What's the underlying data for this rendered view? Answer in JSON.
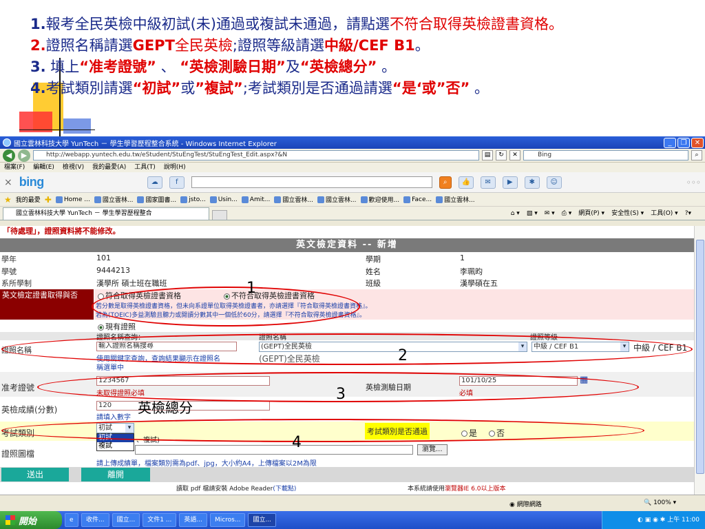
{
  "slide": {
    "line1": {
      "num": "1.",
      "text": "報考全民英檢中級初試(未)通過或複試未通過，請點選",
      "highlight": "不符合取得英檢證書資格。"
    },
    "line2": {
      "num": "2.",
      "text_a": "證照名稱請選",
      "bold_a": "GEPT",
      "red_a": "全民英檢",
      "text_b": ";證照等級請選",
      "red_b": "中級/CEF  B1",
      "end": "。"
    },
    "line3": {
      "num": "3.",
      "text": " 填上",
      "q1": "“准考證號”",
      "sep1": " 、 ",
      "q2": "“英檢測驗日期”",
      "and": "及",
      "q3": "“英檢總分”",
      "end": " 。"
    },
    "line4": {
      "num": "4.",
      "text_a": "考試類別請選",
      "q1": "“初試”",
      "or1": "或",
      "q2": "”複試”",
      "text_b": ";考試類別是否通過請選",
      "q3": "“是‘或”否”",
      "end": " 。"
    }
  },
  "browser": {
    "title": "國立雲林科技大學 YunTech － 學生學習歷程整合系統 - Windows Internet Explorer",
    "url": "http://webapp.yuntech.edu.tw/eStudent/StuEngTest/StuEngTest_Edit.aspx?&N",
    "search_placeholder": "Bing",
    "menu": [
      "檔案(F)",
      "編輯(E)",
      "檢視(V)",
      "我的最愛(A)",
      "工具(T)",
      "說明(H)"
    ],
    "bing_logo": "bing",
    "favorites_label": "我的最愛",
    "favorites": [
      "Home ...",
      "國立雲林...",
      "國家圖書...",
      "jsto...",
      "Usin...",
      "Amit...",
      "國立雲林...",
      "國立雲林...",
      "歡迎使用...",
      "Face...",
      "國立雲林..."
    ],
    "tab_title": "國立雲林科技大學 YunTech － 學生學習歷程整合",
    "tab_tools": [
      "網頁(P) ▾",
      "安全性(S) ▾",
      "工具(O) ▾"
    ],
    "status_zone": "網際網路",
    "status_zoom": "100%"
  },
  "form": {
    "warning": "「待處理」，證照資料將不能修改。",
    "header": "英文檢定資料 -- 新增",
    "year_label": "學年",
    "year_value": "101",
    "term_label": "學期",
    "term_value": "1",
    "id_label": "學號",
    "id_value": "9444213",
    "name_label": "姓名",
    "name_value": "李珮昀",
    "dept_label": "系所學制",
    "dept_value": "漢學所 碩士班在職班",
    "class_label": "班級",
    "class_value": "漢學碩在五",
    "cert_label": "英文檢定證書取得與否",
    "cert_opt_yes": "符合取得英檢證書資格",
    "cert_opt_no": "不符合取得英檢證書資格",
    "cert_note1": "若分數是取得英檢證書資格，但未向系證單位取得英檢證書者，亦請選擇『符合取得英檢證書資格』。",
    "cert_note2": "若為(TOEIC)多益測驗且聽力或閱讀分數其中一個低於60分，請選擇『不符合取得英檢證書資格』。",
    "existing_cert": "現有證照",
    "cert_name_label": "證照名稱",
    "cert_search_label": "證照名稱查詢：",
    "cert_search_value": "輸入證照名稱搜尋",
    "cert_search_hint1": "使用關鍵字查詢，查詢結果顯示在證照名",
    "cert_search_hint2": "稱選單中",
    "cert_name_col": "證照名稱",
    "cert_name_value": "(GEPT)全民英檢",
    "cert_name_echo": "(GEPT)全民英檢",
    "cert_level_col": "證照等級",
    "cert_level_value": "中級 / CEF B1",
    "cert_level_echo": "中級 / CEF B1",
    "exam_no_label": "准考證號",
    "exam_no_value": "1234567",
    "exam_no_hint": "未取得證照必填",
    "exam_date_label": "英檢測驗日期",
    "exam_date_value": "101/10/25",
    "exam_date_hint": "必填",
    "score_label": "英檢成績(分數)",
    "score_value": "120",
    "score_hint": "請填入數字",
    "type_label": "考試類別",
    "type_value": "初試",
    "type_options": [
      "初試",
      "複試"
    ],
    "type_suffix": "、複試)",
    "pass_label": "考試類別是否通過",
    "pass_yes": "是",
    "pass_no": "否",
    "file_label": "證照圖檔",
    "file_hint": "請上傳成績單，檔案類別需為pdf、jpg，大小約A4，上傳檔案以2M為限",
    "browse": "瀏覽...",
    "send": "送出",
    "leave": "離開",
    "footer_a": "讀取 pdf 檔請安裝 Adobe Reader",
    "footer_a_link": "(下載點)",
    "footer_b": "本系統請使用",
    "footer_b_red": "瀏覽器IE 6.0以上版本"
  },
  "annotations": {
    "n1": "1",
    "n2": "2",
    "n3": "3",
    "n4": "4",
    "score_note": "英檢總分",
    "color": "#e00000"
  },
  "taskbar": {
    "start": "開始",
    "tasks": [
      "收件...",
      "國立...",
      "文件1 ...",
      "英語...",
      "Micros...",
      "國立..."
    ],
    "clock": "上午 11:00"
  }
}
